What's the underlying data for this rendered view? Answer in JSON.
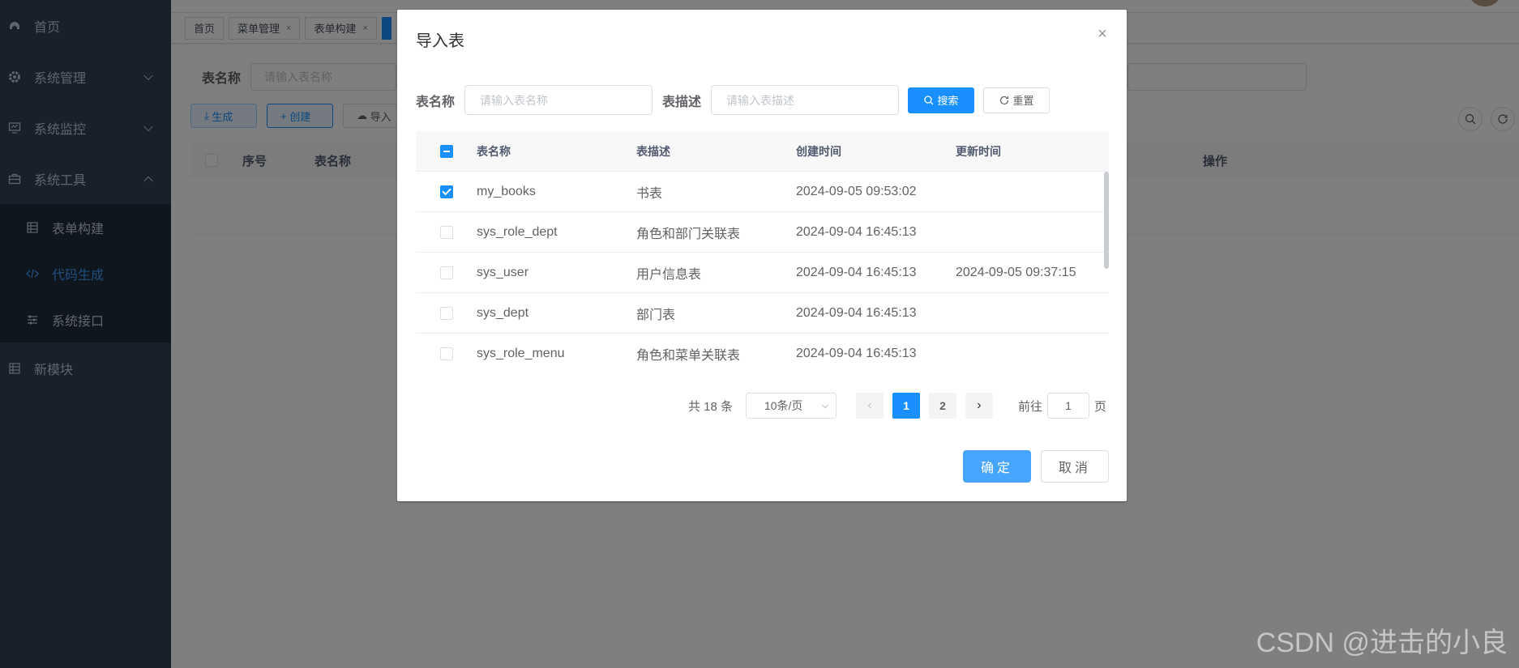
{
  "sidebar": {
    "items": [
      {
        "label": "首页",
        "icon": "dashboard-icon"
      },
      {
        "label": "系统管理",
        "icon": "gear-icon"
      },
      {
        "label": "系统监控",
        "icon": "monitor-icon"
      },
      {
        "label": "系统工具",
        "icon": "toolbox-icon"
      }
    ],
    "submenu": [
      {
        "label": "表单构建",
        "icon": "grid-icon"
      },
      {
        "label": "代码生成",
        "icon": "code-icon",
        "active": true
      },
      {
        "label": "系统接口",
        "icon": "sliders-icon"
      }
    ],
    "extra": {
      "label": "新模块",
      "icon": "grid-icon"
    }
  },
  "tags": {
    "home": "首页",
    "menu": "菜单管理",
    "form": "表单构建",
    "close": "×"
  },
  "background": {
    "label_table_name": "表名称",
    "placeholder_table_name": "请输入表名称",
    "btn_generate": "生成",
    "btn_create": "创建",
    "btn_import": "导入",
    "col_index": "序号",
    "col_table_name": "表名称",
    "col_action": "操作"
  },
  "dialog": {
    "title": "导入表",
    "close": "×",
    "search": {
      "name_label": "表名称",
      "name_placeholder": "请输入表名称",
      "desc_label": "表描述",
      "desc_placeholder": "请输入表描述",
      "search_btn": "搜索",
      "reset_btn": "重置"
    },
    "table": {
      "headers": {
        "name": "表名称",
        "desc": "表描述",
        "created": "创建时间",
        "updated": "更新时间"
      },
      "rows": [
        {
          "name": "my_books",
          "desc": "书表",
          "created": "2024-09-05 09:53:02",
          "updated": "",
          "checked": true
        },
        {
          "name": "sys_role_dept",
          "desc": "角色和部门关联表",
          "created": "2024-09-04 16:45:13",
          "updated": "",
          "checked": false
        },
        {
          "name": "sys_user",
          "desc": "用户信息表",
          "created": "2024-09-04 16:45:13",
          "updated": "2024-09-05 09:37:15",
          "checked": false
        },
        {
          "name": "sys_dept",
          "desc": "部门表",
          "created": "2024-09-04 16:45:13",
          "updated": "",
          "checked": false
        },
        {
          "name": "sys_role_menu",
          "desc": "角色和菜单关联表",
          "created": "2024-09-04 16:45:13",
          "updated": "",
          "checked": false
        }
      ]
    },
    "pager": {
      "total": "共 18 条",
      "page_size": "10条/页",
      "pages": [
        "1",
        "2"
      ],
      "current": "1",
      "goto_label": "前往",
      "goto_value": "1",
      "goto_suffix": "页"
    },
    "ok_btn": "确定",
    "cancel_btn": "取消"
  },
  "watermark": "CSDN @进击的小良",
  "colors": {
    "primary": "#1890ff",
    "sidebar": "#304156",
    "submenu": "#1f2d3d",
    "active_text": "#409eff"
  }
}
